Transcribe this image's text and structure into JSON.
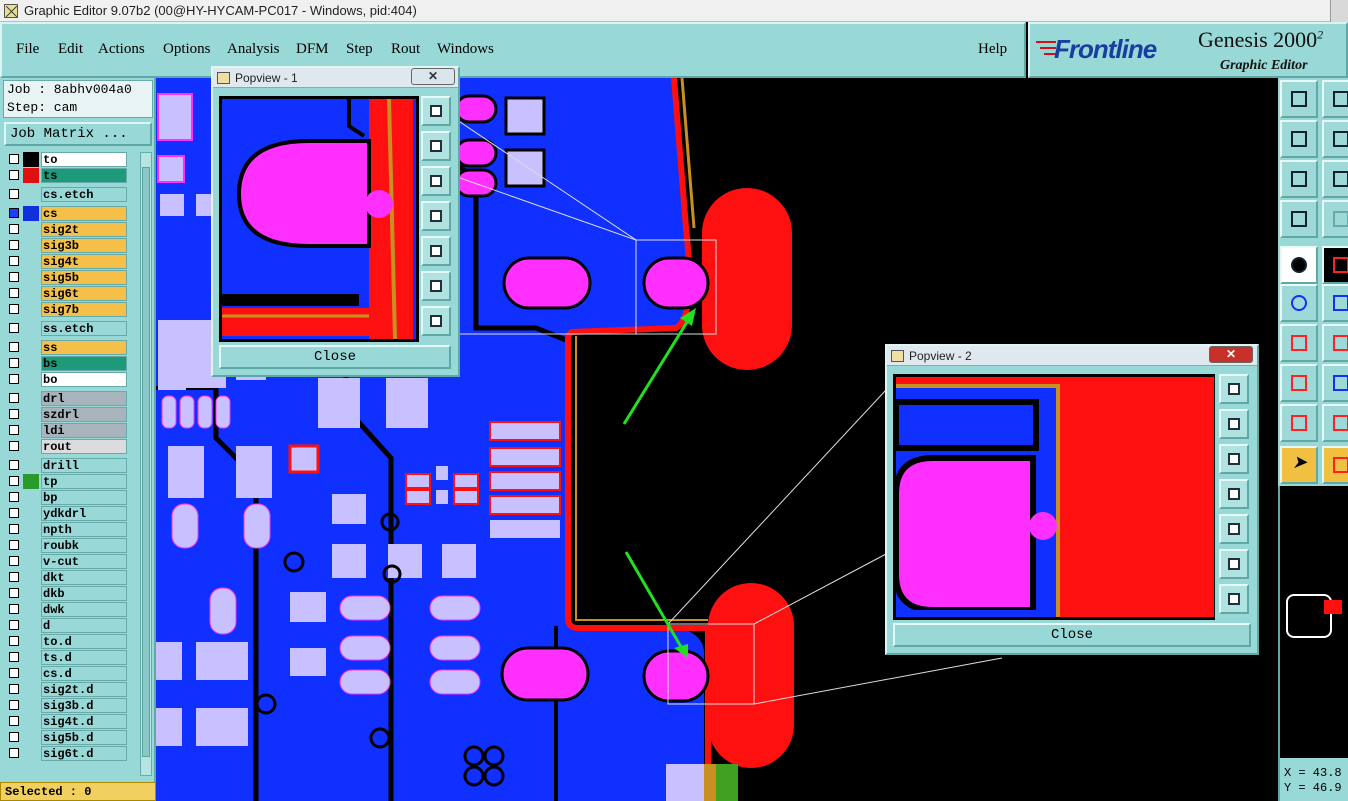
{
  "window": {
    "title": "Graphic Editor 9.07b2 (00@HY-HYCAM-PC017 - Windows, pid:404)"
  },
  "menu": {
    "items": [
      "File",
      "Edit",
      "Actions",
      "Options",
      "Analysis",
      "DFM",
      "Step",
      "Rout",
      "Windows"
    ],
    "help": "Help"
  },
  "brand": {
    "logo": "Frontline",
    "product": "Genesis 2000",
    "version_sup": "2",
    "subtitle": "Graphic Editor"
  },
  "job": {
    "job_line": "Job : 8abhv004a0",
    "step_line": "Step: cam",
    "matrix_button": "Job Matrix ..."
  },
  "layers": [
    {
      "name": "to",
      "swatch": "#000000",
      "bg": "#ffffff",
      "checked": false
    },
    {
      "name": "ts",
      "swatch": "#e01010",
      "bg": "#1d9a7a",
      "checked": false
    },
    {
      "name": "cs.etch",
      "swatch": "",
      "bg": "#98d8d6",
      "checked": false
    },
    {
      "name": "cs",
      "swatch": "#1030e0",
      "bg": "#f4c04a",
      "checked": true
    },
    {
      "name": "sig2t",
      "swatch": "",
      "bg": "#f4c04a",
      "checked": false
    },
    {
      "name": "sig3b",
      "swatch": "",
      "bg": "#f4c04a",
      "checked": false
    },
    {
      "name": "sig4t",
      "swatch": "",
      "bg": "#f4c04a",
      "checked": false
    },
    {
      "name": "sig5b",
      "swatch": "",
      "bg": "#f4c04a",
      "checked": false
    },
    {
      "name": "sig6t",
      "swatch": "",
      "bg": "#f4c04a",
      "checked": false
    },
    {
      "name": "sig7b",
      "swatch": "",
      "bg": "#f4c04a",
      "checked": false
    },
    {
      "name": "ss.etch",
      "swatch": "",
      "bg": "#98d8d6",
      "checked": false
    },
    {
      "name": "ss",
      "swatch": "",
      "bg": "#f4c04a",
      "checked": false
    },
    {
      "name": "bs",
      "swatch": "",
      "bg": "#1d9a7a",
      "checked": false
    },
    {
      "name": "bo",
      "swatch": "",
      "bg": "#ffffff",
      "checked": false
    },
    {
      "name": "drl",
      "swatch": "",
      "bg": "#a8b4bc",
      "checked": false
    },
    {
      "name": "szdrl",
      "swatch": "",
      "bg": "#a8b4bc",
      "checked": false
    },
    {
      "name": "ldi",
      "swatch": "",
      "bg": "#a8b4bc",
      "checked": false
    },
    {
      "name": "rout",
      "swatch": "",
      "bg": "#dcdcdc",
      "checked": false
    },
    {
      "name": "drill",
      "swatch": "",
      "bg": "#98d8d6",
      "checked": false
    },
    {
      "name": "tp",
      "swatch": "#2a9a2a",
      "bg": "#98d8d6",
      "checked": false
    },
    {
      "name": "bp",
      "swatch": "",
      "bg": "#98d8d6",
      "checked": false
    },
    {
      "name": "ydkdrl",
      "swatch": "",
      "bg": "#98d8d6",
      "checked": false
    },
    {
      "name": "npth",
      "swatch": "",
      "bg": "#98d8d6",
      "checked": false
    },
    {
      "name": "roubk",
      "swatch": "",
      "bg": "#98d8d6",
      "checked": false
    },
    {
      "name": "v-cut",
      "swatch": "",
      "bg": "#98d8d6",
      "checked": false
    },
    {
      "name": "dkt",
      "swatch": "",
      "bg": "#98d8d6",
      "checked": false
    },
    {
      "name": "dkb",
      "swatch": "",
      "bg": "#98d8d6",
      "checked": false
    },
    {
      "name": "dwk",
      "swatch": "",
      "bg": "#98d8d6",
      "checked": false
    },
    {
      "name": "d",
      "swatch": "",
      "bg": "#98d8d6",
      "checked": false
    },
    {
      "name": "to.d",
      "swatch": "",
      "bg": "#98d8d6",
      "checked": false
    },
    {
      "name": "ts.d",
      "swatch": "",
      "bg": "#98d8d6",
      "checked": false
    },
    {
      "name": "cs.d",
      "swatch": "",
      "bg": "#98d8d6",
      "checked": false
    },
    {
      "name": "sig2t.d",
      "swatch": "",
      "bg": "#98d8d6",
      "checked": false
    },
    {
      "name": "sig3b.d",
      "swatch": "",
      "bg": "#98d8d6",
      "checked": false
    },
    {
      "name": "sig4t.d",
      "swatch": "",
      "bg": "#98d8d6",
      "checked": false
    },
    {
      "name": "sig5b.d",
      "swatch": "",
      "bg": "#98d8d6",
      "checked": false
    },
    {
      "name": "sig6t.d",
      "swatch": "",
      "bg": "#98d8d6",
      "checked": false
    }
  ],
  "status": {
    "selected": "Selected : 0"
  },
  "popview1": {
    "title": "Popview - 1",
    "close_label": "Close"
  },
  "popview2": {
    "title": "Popview - 2",
    "close_label": "Close"
  },
  "coords": {
    "x": "X = 43.8",
    "y": "Y = 46.9"
  },
  "colors": {
    "panel": "#98d8d6",
    "copper": "#1030ff",
    "pad": "#ff30ff",
    "mask": "#ff1010",
    "smd": "#c8c0ff",
    "outline": "#c89020",
    "arrow": "#20e020"
  },
  "icons": [
    "zoom-icon",
    "pan-up-icon",
    "pan-down-icon",
    "pan-left-icon",
    "pan-right-icon",
    "fit-icon",
    "center-icon"
  ]
}
